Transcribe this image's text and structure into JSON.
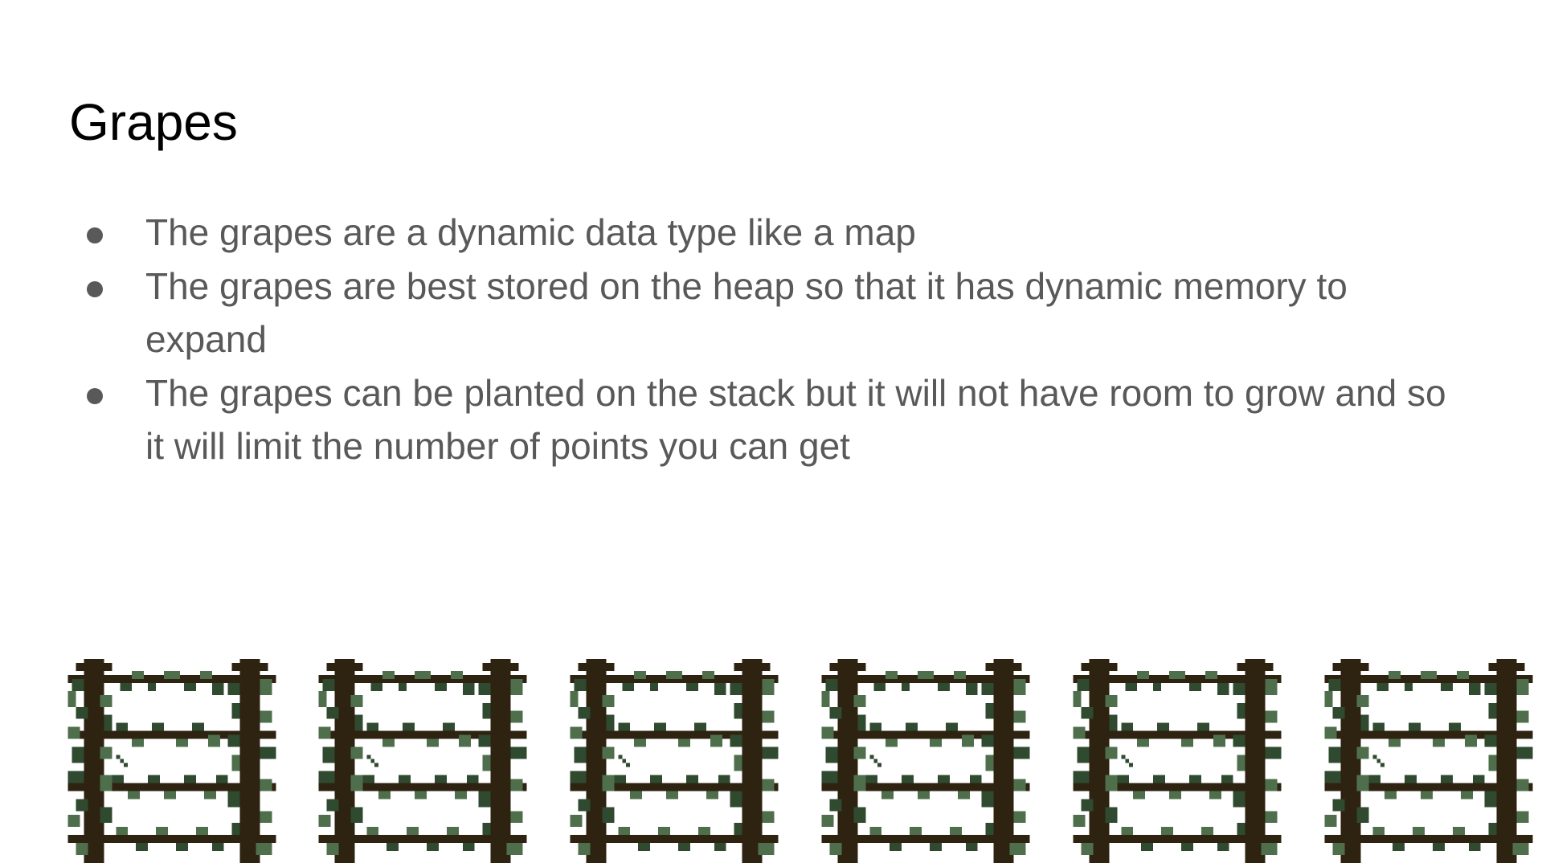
{
  "slide": {
    "title": "Grapes",
    "bullets": [
      "The grapes are a dynamic data type like a map",
      "The grapes are best stored on the heap so that it has dynamic memory to expand",
      "The grapes can be planted on the stack but it will not have room to grow and so it will limit the number of points you can get"
    ]
  },
  "colors": {
    "title_text": "#000000",
    "body_text": "#595959",
    "post_wood": "#2e2311",
    "vine_dark": "#2f4a2f",
    "vine_light": "#4f6f4c"
  },
  "images": {
    "trellis_count": 6,
    "icon": "grape-trellis-icon"
  }
}
